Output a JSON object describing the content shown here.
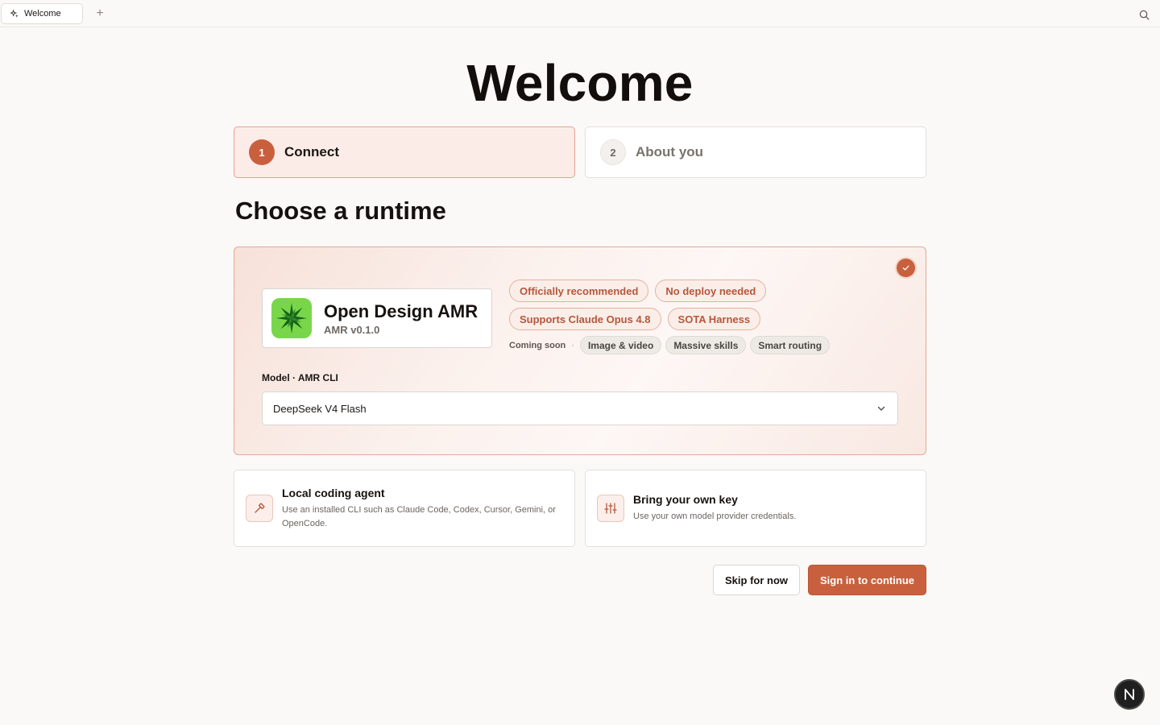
{
  "tabbar": {
    "tab_label": "Welcome",
    "tab_icon": "sparkles-icon",
    "new_tab_symbol": "+",
    "search_icon": "search-icon"
  },
  "page": {
    "title": "Welcome"
  },
  "steps": [
    {
      "number": "1",
      "label": "Connect",
      "state": "active"
    },
    {
      "number": "2",
      "label": "About you",
      "state": "inactive"
    }
  ],
  "section_title": "Choose a runtime",
  "runtime": {
    "selected": true,
    "product_name": "Open Design AMR",
    "product_version": "AMR v0.1.0",
    "logo_icon": "green-starburst-logo",
    "badges_row1": [
      "Officially recommended",
      "No deploy needed"
    ],
    "badges_row2": [
      "Supports Claude Opus 4.8",
      "SOTA Harness"
    ],
    "coming_soon_label": "Coming soon",
    "coming_soon_separator": "·",
    "coming_soon_items": [
      "Image & video",
      "Massive skills",
      "Smart routing"
    ],
    "model_label": "Model · AMR CLI",
    "model_value": "DeepSeek V4 Flash"
  },
  "options": [
    {
      "icon": "hammer-icon",
      "title": "Local coding agent",
      "description": "Use an installed CLI such as Claude Code, Codex, Cursor, Gemini, or OpenCode."
    },
    {
      "icon": "sliders-icon",
      "title": "Bring your own key",
      "description": "Use your own model provider credentials."
    }
  ],
  "actions": {
    "skip_label": "Skip for now",
    "signin_label": "Sign in to continue"
  },
  "floating_badge": "N",
  "colors": {
    "accent": "#c8603e",
    "background": "#faf9f7",
    "logo_green": "#79d64b"
  }
}
